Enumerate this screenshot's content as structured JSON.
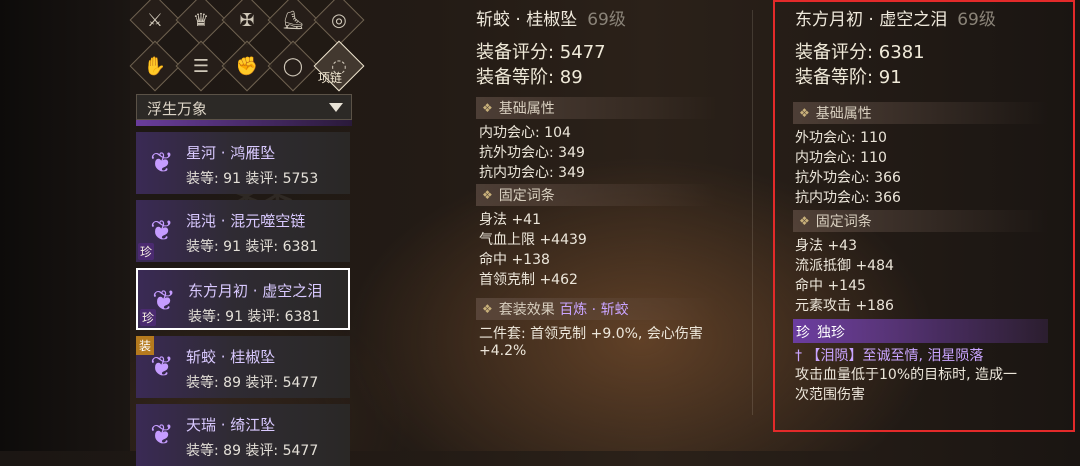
{
  "slots": [
    {
      "icon": "sword-icon",
      "glyph": "⚔"
    },
    {
      "icon": "hat-icon",
      "glyph": "♛"
    },
    {
      "icon": "armor-icon",
      "glyph": "✠"
    },
    {
      "icon": "boots-icon",
      "glyph": "⛸"
    },
    {
      "icon": "ring-icon",
      "glyph": "◎"
    },
    {
      "icon": "bracer-icon",
      "glyph": "✋"
    },
    {
      "icon": "belt-icon",
      "glyph": "☰"
    },
    {
      "icon": "glove-icon",
      "glyph": "✊"
    },
    {
      "icon": "bracelet-icon",
      "glyph": "◯"
    },
    {
      "icon": "necklace-icon",
      "glyph": "◌"
    }
  ],
  "active_slot_label": "项链",
  "dropdown": {
    "value": "浮生万象"
  },
  "items": [
    {
      "name": "星河 · 鸿雁坠",
      "sub": "装等: 91  装评: 5753",
      "badge": ""
    },
    {
      "name": "混沌 · 混元噬空链",
      "sub": "装等: 91  装评: 6381",
      "badge": "珍"
    },
    {
      "name": "东方月初 · 虚空之泪",
      "sub": "装等: 91  装评: 6381",
      "badge": "珍"
    },
    {
      "name": "斩蛟 · 桂椒坠",
      "sub": "装等: 89  装评: 5477",
      "badge": "装"
    },
    {
      "name": "天瑞 · 绮江坠",
      "sub": "装等: 89  装评: 5477",
      "badge": ""
    }
  ],
  "middle": {
    "title": "斩蛟 · 桂椒坠",
    "level": "69级",
    "score": "装备评分: 5477",
    "rank": "装备等阶: 89",
    "base_head": "基础属性",
    "base_stats": [
      "内功会心: 104",
      "抗外功会心: 349",
      "抗内功会心: 349"
    ],
    "fixed_head": "固定词条",
    "fixed_stats": [
      "身法 +41",
      "气血上限 +4439",
      "命中 +138",
      "首领克制 +462"
    ],
    "set_head_prefix": "套装效果",
    "set_name": "百炼 · 斩蛟",
    "set_desc_1": "二件套: 首领克制 +9.0%, 会心伤害",
    "set_desc_2": "+4.2%"
  },
  "right": {
    "title": "东方月初 · 虚空之泪",
    "level": "69级",
    "score": "装备评分: 6381",
    "rank": "装备等阶: 91",
    "base_head": "基础属性",
    "base_stats": [
      "外功会心: 110",
      "内功会心: 110",
      "抗外功会心: 366",
      "抗内功会心: 366"
    ],
    "fixed_head": "固定词条",
    "fixed_stats": [
      "身法 +43",
      "流派抵御 +484",
      "命中 +145",
      "元素攻击 +186"
    ],
    "unique_badge": "珍",
    "unique_head": "独珍",
    "unique_line": "【泪陨】至诚至情, 泪星陨落",
    "unique_desc_1": "攻击血量低于10%的目标时, 造成一",
    "unique_desc_2": "次范围伤害"
  },
  "colors": {
    "highlight_box": "#e32a2a",
    "rare_purple": "#6b3da0"
  }
}
